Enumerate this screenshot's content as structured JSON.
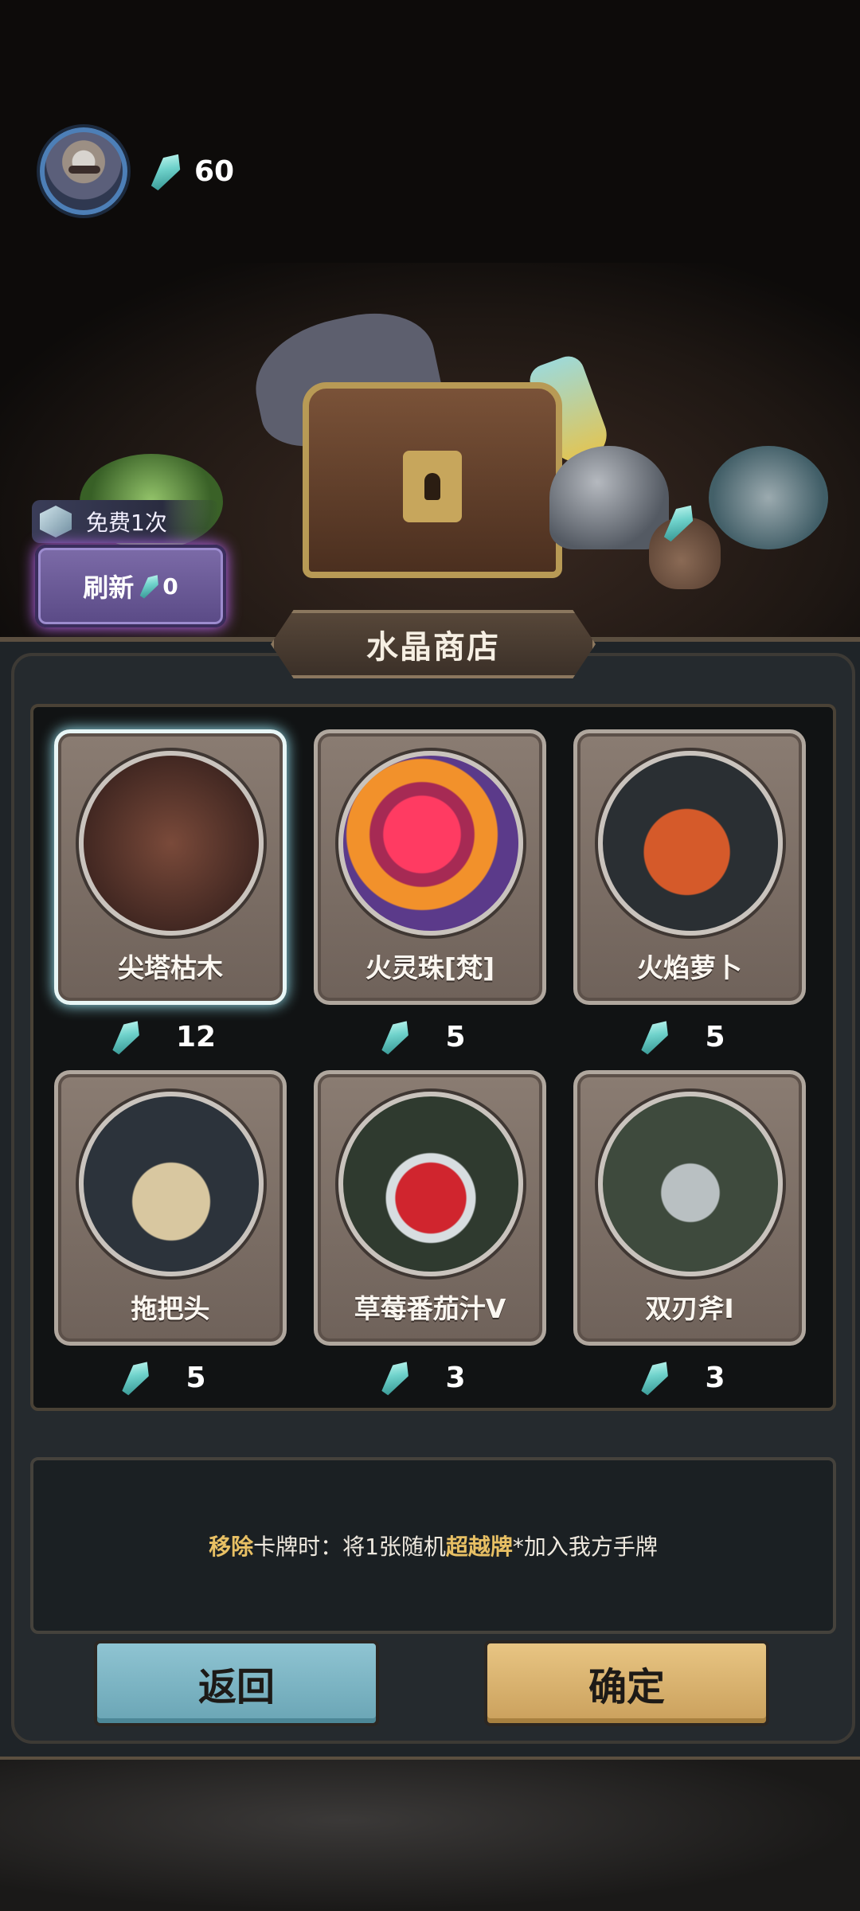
{
  "player": {
    "crystals": "60"
  },
  "refresh": {
    "free_text": "免费1次",
    "label": "刷新",
    "cost": "0"
  },
  "shop": {
    "title": "水晶商店"
  },
  "cards": [
    {
      "name": "尖塔枯木",
      "price": "12",
      "selected": true
    },
    {
      "name": "火灵珠[梵]",
      "price": "5"
    },
    {
      "name": "火焰萝卜",
      "price": "5"
    },
    {
      "name": "拖把头",
      "price": "5"
    },
    {
      "name": "草莓番茄汁V",
      "price": "3"
    },
    {
      "name": "双刃斧I",
      "price": "3"
    }
  ],
  "description": {
    "part1": "移除",
    "part2": "卡牌时：将1张随机",
    "part3": "超越牌",
    "part4": "*加入我方手牌"
  },
  "buttons": {
    "back": "返回",
    "confirm": "确定"
  },
  "colors": {
    "crystal": "#6fd2cb",
    "highlight": "#e8c064",
    "back": "#8fc4d2",
    "confirm": "#e8c583"
  }
}
